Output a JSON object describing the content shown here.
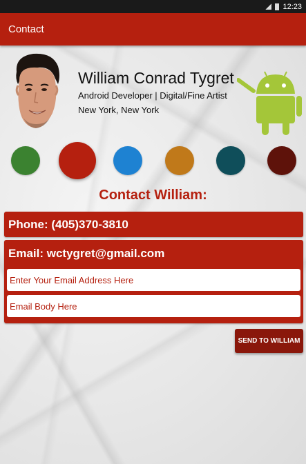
{
  "status_bar": {
    "time": "12:23"
  },
  "app_bar": {
    "title": "Contact"
  },
  "profile": {
    "name": "William Conrad Tygret",
    "role": "Android Developer | Digital/Fine Artist",
    "location": "New York, New York"
  },
  "color_swatches": [
    {
      "color": "#3b8230",
      "selected": false
    },
    {
      "color": "#b5200f",
      "selected": true
    },
    {
      "color": "#1e82d2",
      "selected": false
    },
    {
      "color": "#c0791a",
      "selected": false
    },
    {
      "color": "#0f4e5a",
      "selected": false
    },
    {
      "color": "#5e120a",
      "selected": false
    }
  ],
  "contact": {
    "heading": "Contact William:",
    "phone": "Phone: (405)370-3810",
    "email": "Email: wctygret@gmail.com",
    "email_input_placeholder": "Enter Your Email Address Here",
    "body_input_placeholder": "Email Body Here",
    "send_label": "SEND TO WILLIAM"
  },
  "colors": {
    "primary": "#b5200f",
    "android_green": "#a4c639"
  }
}
